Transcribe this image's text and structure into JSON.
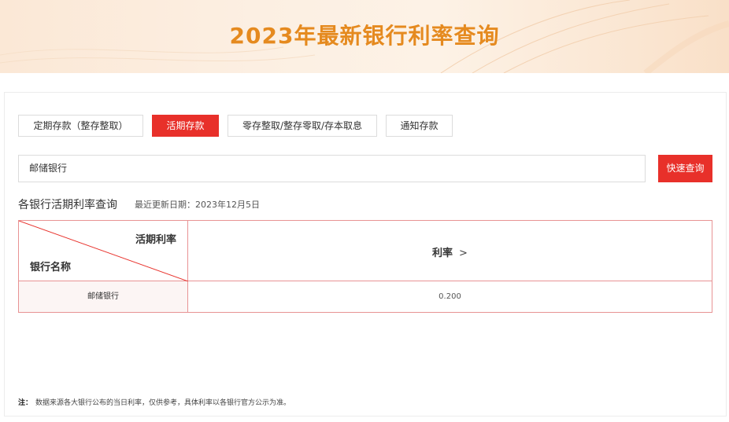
{
  "banner": {
    "title": "2023年最新银行利率查询"
  },
  "tabs": [
    {
      "label": "定期存款（整存整取）",
      "active": false
    },
    {
      "label": "活期存款",
      "active": true
    },
    {
      "label": "零存整取/整存零取/存本取息",
      "active": false
    },
    {
      "label": "通知存款",
      "active": false
    }
  ],
  "search": {
    "value": "邮储银行",
    "button_label": "快速查询"
  },
  "section": {
    "title": "各银行活期利率查询",
    "update_text": "最近更新日期：2023年12月5日"
  },
  "table": {
    "header_top_right": "活期利率",
    "header_bottom_left": "银行名称",
    "rate_header": "利率",
    "rate_header_icon": "chevron-right-icon",
    "rows": [
      {
        "bank": "邮储银行",
        "rate": "0.200"
      }
    ]
  },
  "note": {
    "label": "注：",
    "text": "数据来源各大银行公布的当日利率，仅供参考，具体利率以各银行官方公示为准。"
  },
  "colors": {
    "accent": "#e8302a",
    "title": "#e58a1f",
    "table_border": "#e89394",
    "row_bg": "#fcf5f4"
  }
}
